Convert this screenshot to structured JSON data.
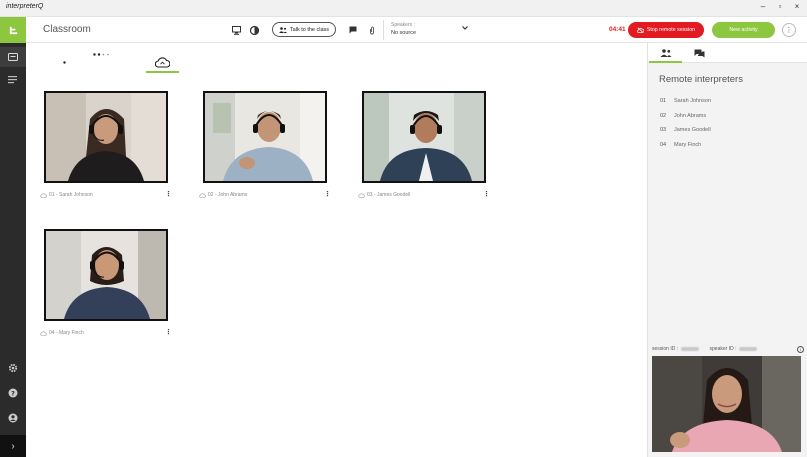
{
  "window": {
    "app_name": "interpreterQ",
    "controls": [
      "–",
      "▫",
      "×"
    ]
  },
  "sidebar": {
    "logo_icon": "interpreterq-logo",
    "items": [
      {
        "icon": "screen-icon",
        "active": true
      },
      {
        "icon": "menu-icon",
        "active": false
      }
    ],
    "bottom_items": [
      {
        "icon": "gear-icon"
      },
      {
        "icon": "help-icon"
      },
      {
        "icon": "user-icon"
      }
    ],
    "expand_label": "›"
  },
  "topbar": {
    "title": "Classroom",
    "talk_to_class_label": "Talk to the class",
    "speakers": {
      "label": "Speakers :",
      "value": "No source"
    },
    "timer": "04:41",
    "stop_button_label": "Stop remote session",
    "new_activity_label": "New activity",
    "more_label": "⋮"
  },
  "view_tabs": {
    "items": [
      {
        "name": "dot-view",
        "active": false
      },
      {
        "name": "grid-view",
        "active": false
      },
      {
        "name": "cloud-view",
        "active": true
      }
    ]
  },
  "tiles": [
    {
      "caption": "01 - Sarah Johnson",
      "menu": "⋮"
    },
    {
      "caption": "02 - John Abrams",
      "menu": "⋮"
    },
    {
      "caption": "03 - James Goodell",
      "menu": "⋮"
    },
    {
      "caption": "04 - Mary Finch",
      "menu": "⋮"
    }
  ],
  "right_panel": {
    "tabs": [
      {
        "icon": "people-icon",
        "active": true
      },
      {
        "icon": "chat-icon",
        "active": false
      }
    ],
    "title": "Remote interpreters",
    "interpreters": [
      {
        "num": "01",
        "name": "Sarah Johnson"
      },
      {
        "num": "02",
        "name": "John Abrams"
      },
      {
        "num": "03",
        "name": "James Goodell"
      },
      {
        "num": "04",
        "name": "Mary Finch"
      }
    ],
    "session_id_label": "session ID :",
    "speaker_id_label": "speaker ID :",
    "info_label": "i"
  },
  "colors": {
    "accent_green": "#8dc63f",
    "stop_red": "#e21b22",
    "sidebar_dark": "#2b2b2b"
  }
}
